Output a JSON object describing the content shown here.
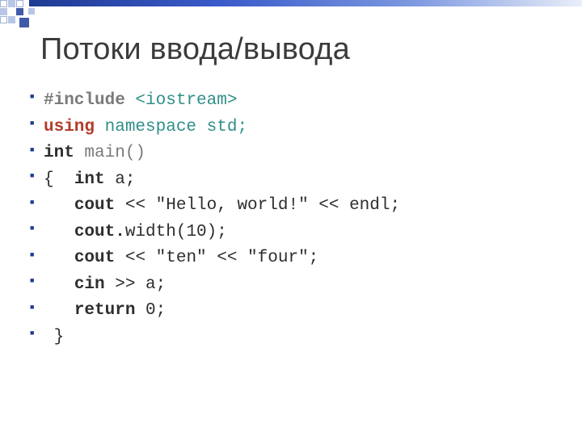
{
  "title": "Потоки ввода/вывода",
  "code": {
    "include_kw": "#include",
    "include_hdr": " <iostream>",
    "using_kw": "using",
    "using_rest": " namespace std",
    "semicolon": ";",
    "int_kw": "int",
    "main_sig": " main()",
    "open_brace": "{  ",
    "decl_a": " a;",
    "cout_kw": "cout",
    "cout_dot": "cout.",
    "hello_tail": " << \"Hello, world!\" << endl;",
    "width_tail": "width(10);",
    "tenfour_tail": " << \"ten\" << \"four\";",
    "cin_kw": "cin",
    "cin_tail": " >> a;",
    "return_kw": "return",
    "return_tail": " 0;",
    "close_brace": " }",
    "indent3": "   ",
    "indent1": " "
  }
}
